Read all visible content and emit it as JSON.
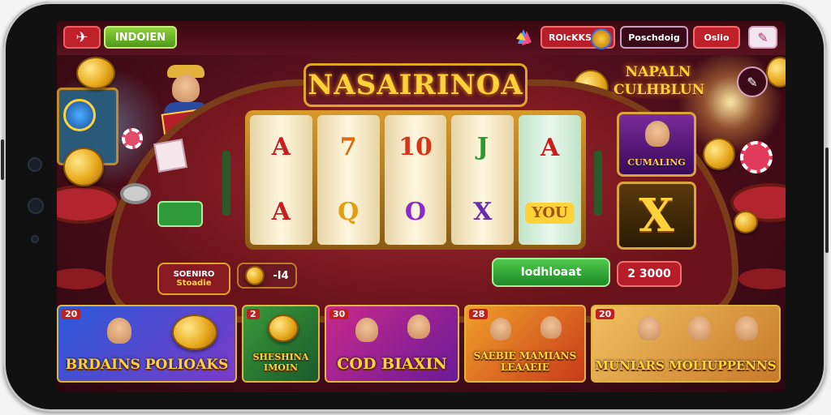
{
  "topbar": {
    "back_icon": "plane-icon",
    "left_label": "INDOIEN",
    "gem_icon": "gem-icon",
    "coins_label": "ROlcKKS",
    "profile_label": "Poschdoig",
    "info_label": "Oslio",
    "settings_icon": "wrench-icon"
  },
  "slot": {
    "title": "NASAIRINOA",
    "reels": [
      [
        "A",
        "A"
      ],
      [
        "7",
        "Q"
      ],
      [
        "10",
        "O"
      ],
      [
        "J",
        "X"
      ],
      [
        "A",
        "YOU"
      ]
    ]
  },
  "right_sign": {
    "line1": "NAPALN",
    "line2": "CULHBLUN"
  },
  "side_cards": [
    {
      "label": "CUMALING"
    },
    {
      "label": "X"
    }
  ],
  "bottom_left": {
    "line1": "SOENIRO",
    "line2": "Stoadie"
  },
  "coin_counter": {
    "value": "-I4"
  },
  "spin_button": {
    "label": "Iodhloaat"
  },
  "bet": {
    "value": "2 3000"
  },
  "games": [
    {
      "badge": "20",
      "title": "BRDAINS  POLIOAKS"
    },
    {
      "badge": "2",
      "title": "SHESHINA  IMOIN"
    },
    {
      "badge": "30",
      "title": "COD  BIAXIN"
    },
    {
      "badge": "28",
      "title": "SAEBIE MAMIANS  LEAAEIE"
    },
    {
      "badge": "20",
      "title": "MUNIARS  MOLIUPPENNS"
    }
  ],
  "colors": {
    "accent_gold": "#ffd23a",
    "felt_red": "#a42a33",
    "spin_green": "#2fa83a"
  }
}
